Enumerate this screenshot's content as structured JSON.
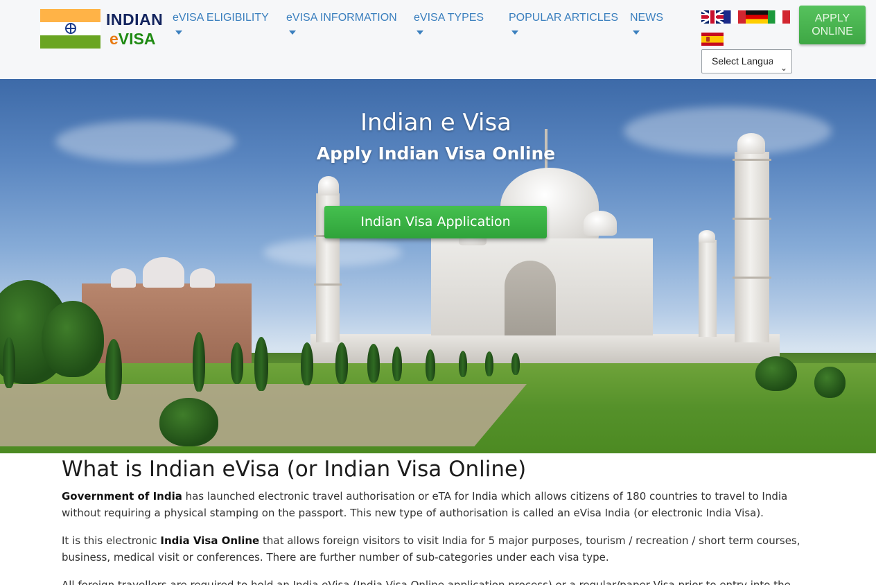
{
  "logo": {
    "line1": "INDIAN",
    "line2_e": "e",
    "line2_visa": "VISA"
  },
  "nav": {
    "items": [
      {
        "label": "eVISA ELIGIBILITY"
      },
      {
        "label": "eVISA INFORMATION"
      },
      {
        "label": "eVISA TYPES"
      },
      {
        "label": "POPULAR ARTICLES"
      },
      {
        "label": "NEWS"
      }
    ]
  },
  "languages": {
    "flags": [
      "flag-english-icon",
      "flag-french-icon",
      "flag-german-icon",
      "flag-italian-icon",
      "flag-spanish-icon"
    ],
    "select_value": "Select Language",
    "select_arrow": "⌄"
  },
  "apply_button": {
    "line1": "APPLY",
    "line2": "ONLINE"
  },
  "hero": {
    "title": "Indian e Visa",
    "subtitle": "Apply Indian Visa Online",
    "button": "Indian Visa Application"
  },
  "article": {
    "heading": "What is Indian eVisa (or Indian Visa Online)",
    "p1_bold": "Government of India",
    "p1_rest": " has launched electronic travel authorisation or eTA for India which allows citizens of 180 countries to travel to India without requiring a physical stamping on the passport. This new type of authorisation is called an eVisa India (or electronic India Visa).",
    "p2_start": "It is this electronic ",
    "p2_bold": "India Visa Online",
    "p2_rest": " that allows foreign visitors to visit India for 5 major purposes, tourism / recreation / short term courses, business, medical visit or conferences. There are further number of sub-categories under each visa type.",
    "p3": "All foreign travellers are required to hold an India eVisa (India Visa Online application process) or a regular/paper Visa prior to entry into the country as"
  },
  "colors": {
    "nav_link": "#3a7fbe",
    "apply_green": "#3ea744",
    "logo_navy": "#13245e",
    "logo_orange": "#e87a12",
    "logo_green": "#1e8a12"
  }
}
